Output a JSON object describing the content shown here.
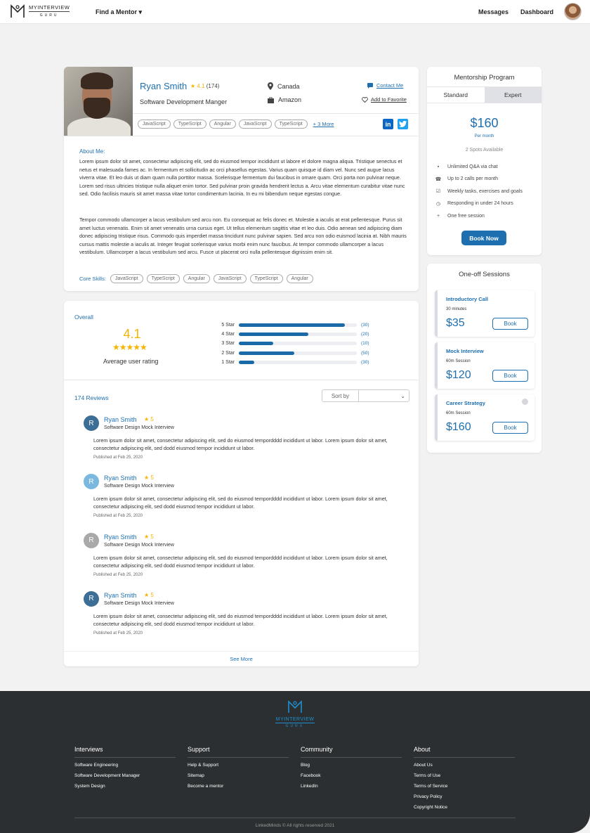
{
  "header": {
    "logo_text": "MYINTERVIEW",
    "logo_sub": "GURU",
    "find_mentor": "Find a Mentor ▾",
    "messages": "Messages",
    "dashboard": "Dashboard"
  },
  "profile": {
    "name": "Ryan Smith",
    "rating": "4.1",
    "rating_count": "(174)",
    "title": "Software Development Manger",
    "location": "Canada",
    "company": "Amazon",
    "contact": "Contact Me",
    "favorite": "Add to Favorite",
    "tags": [
      "JavaScript",
      "TypeScript",
      "Angular",
      "JavaScript",
      "TypeScript"
    ],
    "more_tags": "+ 3 More",
    "about_heading": "About Me:",
    "about_p1": "Lorem ipsum dolor sit amet, consectetur adipiscing elit, sed do eiusmod tempor incididunt ut labore et dolore magna aliqua. Tristique senectus et netus et malesuada fames ac. In fermentum et sollicitudin ac orci phasellus egestas. Varius quam quisque id diam vel. Nunc sed augue lacus viverra vitae. Et leo duis ut diam quam nulla porttitor massa. Scelerisque fermentum dui faucibus in ornare quam. Orci porta non pulvinar neque. Lorem sed risus ultricies tristique nulla aliquet enim tortor. Sed pulvinar proin gravida hendrerit lectus a. Arcu vitae elementum curabitur vitae nunc sed. Odio facilisis mauris sit amet massa vitae tortor condimentum lacinia. In eu mi bibendum neque egestas congue.",
    "about_p2": "Tempor commodo ullamcorper a lacus vestibulum sed arcu non. Eu consequat ac felis donec et. Molestie a iaculis at erat pellentesque. Purus sit amet luctus venenatis. Enim sit amet venenatis urna cursus eget. Ut tellus elementum sagittis vitae et leo duis. Odio aenean sed adipiscing diam donec adipiscing tristique risus. Commodo quis imperdiet massa tincidunt nunc pulvinar sapien. Sed arcu non odio euismod lacinia at. Nibh mauris cursus mattis molestie a iaculis at. Integer feugiat scelerisque varius morbi enim nunc faucibus. At tempor commodo ullamcorper a lacus vestibulum. Ullamcorper a lacus vestibulum sed arcu. Fusce ut placerat orci nulla pellentesque dignissim enim sit.",
    "core_label": "Core Skills:",
    "core_skills": [
      "JavaScript",
      "TypeScript",
      "Angular",
      "JavaScript",
      "TypeScript",
      "Angular"
    ]
  },
  "program": {
    "title": "Mentorship Program",
    "tab_standard": "Standard",
    "tab_expert": "Expert",
    "price": "$160",
    "per": "Per month",
    "spots": "2 Spots Available",
    "features": [
      {
        "icon": "chat-icon",
        "glyph": "▪",
        "text": "Unlimited Q&A via chat"
      },
      {
        "icon": "phone-icon",
        "glyph": "☎",
        "text": "Up to 2 calls per month"
      },
      {
        "icon": "checkbox-icon",
        "glyph": "☑",
        "text": "Weekly tasks, exercises and goals"
      },
      {
        "icon": "clock-icon",
        "glyph": "◷",
        "text": "Responding in under 24 hours"
      },
      {
        "icon": "plus-icon",
        "glyph": "+",
        "text": "One free session"
      }
    ],
    "book_now": "Book Now"
  },
  "oneoff": {
    "title": "One-off Sessions",
    "sessions": [
      {
        "name": "Introductory Call",
        "duration": "30 minutes",
        "price": "$35",
        "button": "Book"
      },
      {
        "name": "Mock Interview",
        "duration": "60m Session",
        "price": "$120",
        "button": "Book"
      },
      {
        "name": "Career Strategy",
        "duration": "60m Session",
        "price": "$160",
        "button": "Book"
      }
    ]
  },
  "ratings": {
    "overall_label": "Overall",
    "average": "4.1",
    "stars": "★★★★★",
    "average_label": "Average user rating",
    "bars": [
      {
        "label": "5 Star",
        "count": "(30)",
        "fill": 0.9
      },
      {
        "label": "4 Star",
        "count": "(20)",
        "fill": 0.59
      },
      {
        "label": "3 Star",
        "count": "(10)",
        "fill": 0.29
      },
      {
        "label": "2 Star",
        "count": "(50)",
        "fill": 0.47
      },
      {
        "label": "1 Star",
        "count": "(30)",
        "fill": 0.13
      }
    ]
  },
  "reviews": {
    "count": "174 Reviews",
    "sort_label": "Sort by",
    "items": [
      {
        "initial": "R",
        "color": "#3d6e96",
        "name": "Ryan Smith",
        "stars": "★ 5",
        "sub": "Software Design Mock Interview",
        "body": "Lorem ipsum dolor sit amet, consectetur adipiscing elit, sed do eiusmod tempordddd incididunt ut labor. Lorem ipsum dolor sit amet, consectetur adipiscing elit, sed dodd eiusmod tempor incididunt ut labor.",
        "date": "Published at Feb 25, 2020"
      },
      {
        "initial": "R",
        "color": "#7ab8e0",
        "name": "Ryan Smith",
        "stars": "★ 5",
        "sub": "Software Design Mock Interview",
        "body": "Lorem ipsum dolor sit amet, consectetur adipiscing elit, sed do eiusmod tempordddd incididunt ut labor. Lorem ipsum dolor sit amet, consectetur adipiscing elit, sed dodd eiusmod tempor incididunt ut labor.",
        "date": "Published at Feb 25, 2020"
      },
      {
        "initial": "R",
        "color": "#a9a9a9",
        "name": "Ryan Smith",
        "stars": "★ 5",
        "sub": "Software Design Mock Interview",
        "body": "Lorem ipsum dolor sit amet, consectetur adipiscing elit, sed do eiusmod tempordddd incididunt ut labor. Lorem ipsum dolor sit amet, consectetur adipiscing elit, sed dodd eiusmod tempor incididunt ut labor.",
        "date": "Published at Feb 25, 2020"
      },
      {
        "initial": "R",
        "color": "#3d6e96",
        "name": "Ryan Smith",
        "stars": "★ 5",
        "sub": "Software Design Mock Interview",
        "body": "Lorem ipsum dolor sit amet, consectetur adipiscing elit, sed do eiusmod tempordddd incididunt ut labor. Lorem ipsum dolor sit amet, consectetur adipiscing elit, sed dodd eiusmod tempor incididunt ut labor.",
        "date": "Published at Feb 25, 2020"
      }
    ],
    "see_more": "See More"
  },
  "footer": {
    "logo_text": "MYINTERVIEW",
    "logo_sub": "GURU",
    "columns": [
      {
        "heading": "Interviews",
        "links": [
          "Software Engineering",
          "Software Development Manager",
          "System Design"
        ]
      },
      {
        "heading": "Support",
        "links": [
          "Help & Support",
          "Sitemap",
          "Become a mentor"
        ]
      },
      {
        "heading": "Community",
        "links": [
          "Blog",
          "Facebook",
          "LinkedIn"
        ]
      },
      {
        "heading": "About",
        "links": [
          "About Us",
          "Terms of Use",
          "Terms of Service",
          "Privacy Policy",
          "Copyright Notice"
        ]
      }
    ],
    "copyright": "LinkedMinds © All rights reserved 2021"
  }
}
